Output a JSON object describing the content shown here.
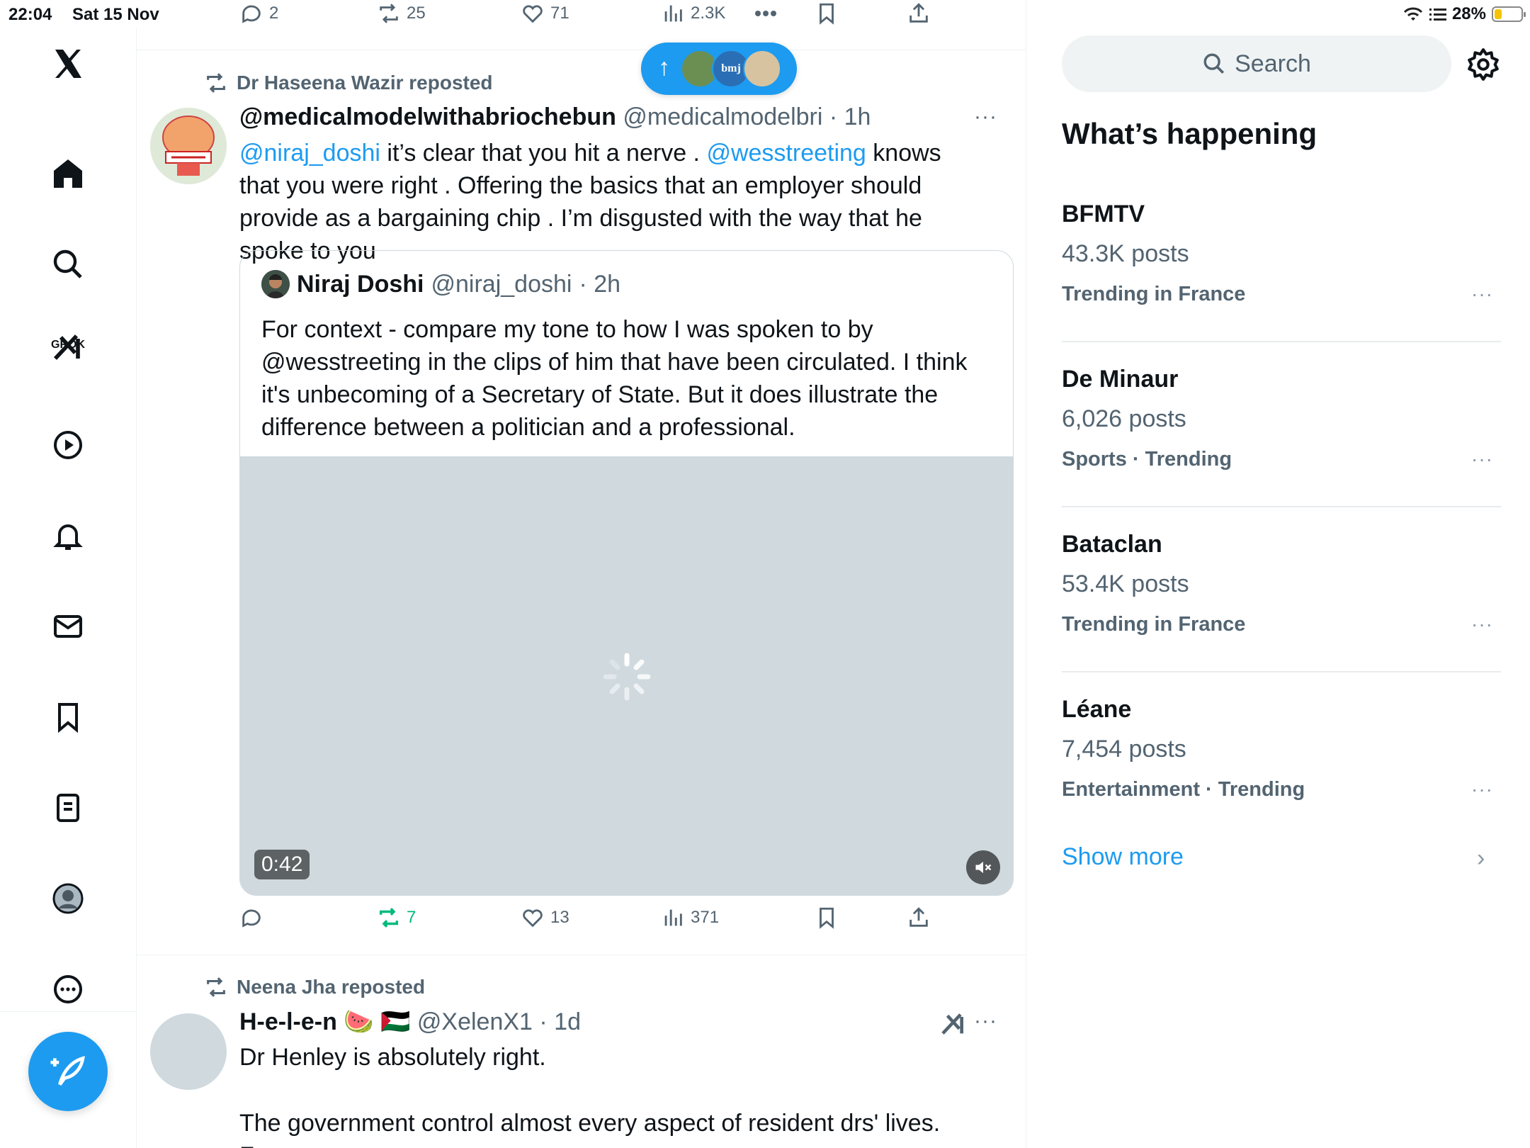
{
  "status_bar": {
    "time": "22:04",
    "date": "Sat 15 Nov",
    "battery": "28%",
    "battery_level": 0.28
  },
  "sidebar": {
    "logo": "x-logo-icon",
    "items": [
      "home-icon",
      "search-icon",
      "grok-icon",
      "video-icon",
      "bell-icon",
      "mail-icon",
      "bookmark-icon",
      "lists-icon",
      "profile-icon",
      "more-icon"
    ],
    "grok_label": "GROK",
    "compose": "compose-icon"
  },
  "prev_actions": {
    "replies": "2",
    "reposts": "25",
    "likes": "71",
    "views": "2.3K"
  },
  "new_posts_pill": {
    "bmj_label": "bmj"
  },
  "tweet1": {
    "reposted_by": "Dr Haseena Wazir reposted",
    "name": "@medicalmodelwithabriochebun",
    "handle": "@medicalmodelbri",
    "time": "· 1h",
    "more": "···",
    "body": {
      "m1": "@niraj_doshi",
      "t1": " it’s clear that you hit a nerve . ",
      "m2": "@wesstreeting",
      "t2": " knows that you were right . Offering the basics that an employer should provide as a bargaining chip . I’m disgusted with the way that he spoke to you"
    },
    "quote": {
      "name": "Niraj Doshi",
      "handle": "@niraj_doshi",
      "time": "· 2h",
      "body": "For context - compare my tone to how I was spoken to by @wesstreeting in the clips of him that have been circulated. I think it's unbecoming of a Secretary of State. But it does illustrate the difference between a politician and a professional.",
      "duration": "0:42"
    },
    "actions": {
      "reposts": "7",
      "likes": "13",
      "views": "371"
    }
  },
  "tweet2": {
    "reposted_by": "Neena Jha reposted",
    "name": "H-e-l-e-n 🍉 🇵🇸",
    "handle": "@XelenX1",
    "time": "· 1d",
    "more": "···",
    "body1": "Dr Henley is absolutely right.",
    "body2": "The government control almost every aspect of resident drs' lives. From"
  },
  "right": {
    "search_placeholder": "Search",
    "section_title": "What’s happening",
    "trends": [
      {
        "name": "BFMTV",
        "posts": "43.3K posts",
        "meta": "Trending in France"
      },
      {
        "name": "De Minaur",
        "posts": "6,026 posts",
        "meta": "Sports · Trending"
      },
      {
        "name": "Bataclan",
        "posts": "53.4K posts",
        "meta": "Trending in France"
      },
      {
        "name": "Léane",
        "posts": "7,454 posts",
        "meta": "Entertainment · Trending"
      }
    ],
    "trend_more": "···",
    "show_more": "Show more",
    "show_more_chevron": "›"
  },
  "colors": {
    "accent": "#1d9bf0",
    "repost_green": "#00ba7c",
    "muted": "#536471"
  }
}
